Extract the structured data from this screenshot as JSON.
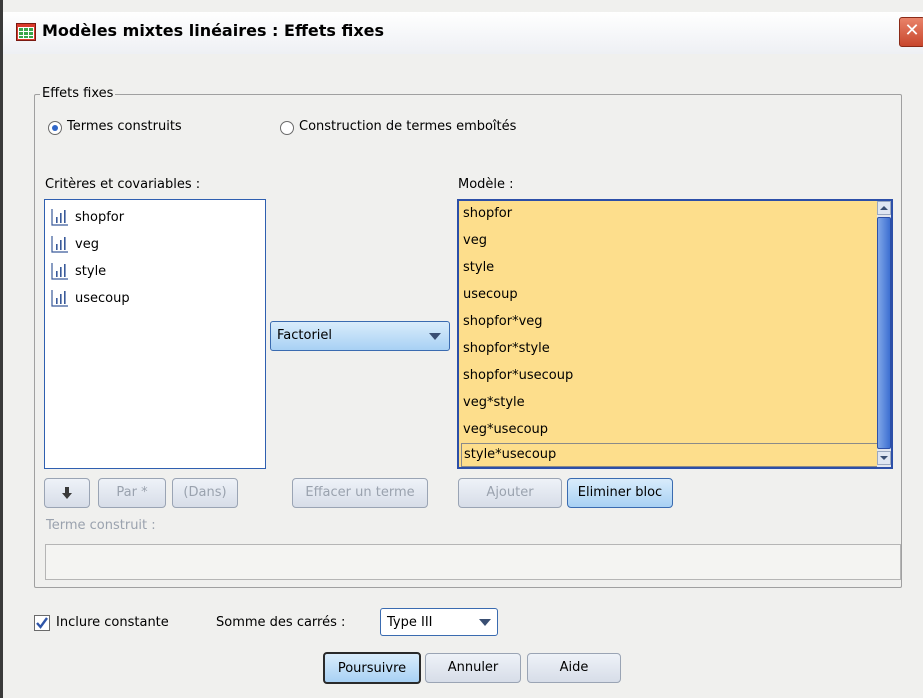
{
  "window": {
    "title": "Modèles mixtes linéaires : Effets fixes",
    "close_glyph": "✕"
  },
  "fixed_effects": {
    "legend": "Effets fixes",
    "radio_build_terms": {
      "label": "Termes construits",
      "selected": true
    },
    "radio_nested_terms": {
      "label": "Construction de termes emboîtés",
      "selected": false
    }
  },
  "factors": {
    "label": "Critères et covariables :",
    "items": [
      "shopfor",
      "veg",
      "style",
      "usecoup"
    ],
    "item_icon": "scale-variable-icon"
  },
  "build_type": {
    "selected": "Factoriel"
  },
  "model": {
    "label": "Modèle :",
    "items": [
      "shopfor",
      "veg",
      "style",
      "usecoup",
      "shopfor*veg",
      "shopfor*style",
      "shopfor*usecoup",
      "veg*style",
      "veg*usecoup",
      "style*usecoup"
    ],
    "highlight_color": "#fdde8c"
  },
  "buttons": {
    "down_arrow": "arrow-down-icon",
    "by": "Par *",
    "within": "(Dans)",
    "remove_term": "Effacer un terme",
    "add": "Ajouter",
    "remove_block": "Eliminer bloc"
  },
  "built_term": {
    "label": "Terme construit :",
    "value": ""
  },
  "options": {
    "include_intercept": {
      "label": "Inclure constante",
      "checked": true
    },
    "sum_of_squares_label": "Somme des carrés :",
    "sum_of_squares_value": "Type III"
  },
  "dialog_buttons": {
    "continue": "Poursuivre",
    "cancel": "Annuler",
    "help": "Aide"
  }
}
